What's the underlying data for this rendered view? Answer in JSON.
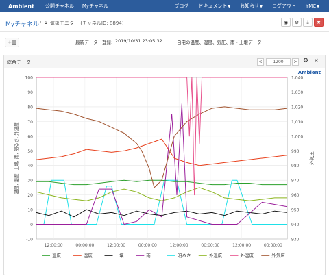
{
  "navbar": {
    "brand": "Ambient",
    "items": [
      "公開チャネル",
      "Myチャネル"
    ],
    "right_items": [
      {
        "label": "ブログ",
        "dropdown": false
      },
      {
        "label": "ドキュメント",
        "dropdown": true
      },
      {
        "label": "お知らせ",
        "dropdown": true
      },
      {
        "label": "ログアウト",
        "dropdown": false
      },
      {
        "label": "YMC",
        "dropdown": true
      }
    ]
  },
  "title": {
    "my_channel": "Myチャネル",
    "separator": "/",
    "channel_title": "気象モニター (チャネルID: 8894)"
  },
  "info": {
    "last_update_label": "最新データー登録:",
    "last_update": "2019/10/31 23:05:32",
    "description": "自宅の温度、湿度、気圧、雨・土壌データ"
  },
  "panel": {
    "title": "総合データ",
    "count": "1200",
    "prev": "<",
    "next": ">",
    "brand": "Ambient"
  },
  "colors": {
    "navbar": "#2c5c9c",
    "temp": "#2ca02c",
    "humidity": "#e8401c",
    "soil": "#111111",
    "rain": "#9b1f9b",
    "brightness": "#1fe0e8",
    "outdoor_temp": "#8ab41c",
    "outdoor_humidity": "#e8508c",
    "outdoor_pressure": "#a0522d"
  },
  "chart_data": {
    "type": "line",
    "x_ticks": [
      "12:00:00",
      "00:00:00",
      "12:00:00",
      "00:00:00",
      "12:00:00",
      "00:00:00",
      "12:00:00",
      "00:00:00"
    ],
    "y_left_label": "温度, 湿度, 土壌, 雨, 明るさ, 外温度",
    "y_left_ticks": [
      100,
      90,
      80,
      70,
      60,
      50,
      40,
      30,
      20,
      10,
      0,
      -10
    ],
    "y_left_range": [
      -10,
      100
    ],
    "y_right_label": "外気圧",
    "y_right_ticks_text": [
      "1,040",
      "1,030",
      "1,020",
      "1,010",
      "1,000",
      "990",
      "980",
      "970",
      "960",
      "950",
      "940",
      "930"
    ],
    "y_right_ticks": [
      1040,
      1030,
      1020,
      1010,
      1000,
      990,
      980,
      970,
      960,
      950,
      940,
      930
    ],
    "y_right_range": [
      930,
      1040
    ],
    "x_range": [
      0,
      1
    ],
    "grid": true,
    "legend_position": "bottom",
    "series": [
      {
        "name": "温度",
        "color": "#2ca02c",
        "axis": "left",
        "x": [
          0,
          0.05,
          0.1,
          0.15,
          0.2,
          0.25,
          0.3,
          0.35,
          0.4,
          0.45,
          0.5,
          0.55,
          0.6,
          0.65,
          0.7,
          0.75,
          0.8,
          0.85,
          0.9,
          0.95,
          1
        ],
        "y": [
          29,
          29,
          28,
          27,
          27,
          28,
          29,
          30,
          29,
          30,
          30,
          29,
          29,
          28,
          27,
          27,
          28,
          28,
          27,
          27,
          27
        ]
      },
      {
        "name": "湿度",
        "color": "#e8401c",
        "axis": "left",
        "x": [
          0,
          0.05,
          0.1,
          0.15,
          0.2,
          0.25,
          0.3,
          0.35,
          0.4,
          0.45,
          0.5,
          0.55,
          0.6,
          0.65,
          0.7,
          0.75,
          0.8,
          0.85,
          0.9,
          0.95,
          1
        ],
        "y": [
          44,
          45,
          46,
          48,
          51,
          50,
          49,
          50,
          52,
          55,
          58,
          45,
          42,
          40,
          41,
          42,
          43,
          44,
          45,
          46,
          47
        ]
      },
      {
        "name": "土壌",
        "color": "#111111",
        "axis": "left",
        "x": [
          0,
          0.05,
          0.1,
          0.15,
          0.2,
          0.25,
          0.3,
          0.35,
          0.4,
          0.45,
          0.5,
          0.55,
          0.6,
          0.65,
          0.7,
          0.75,
          0.8,
          0.85,
          0.9,
          0.95,
          1
        ],
        "y": [
          8,
          6,
          9,
          5,
          10,
          7,
          8,
          6,
          9,
          7,
          6,
          8,
          9,
          7,
          8,
          6,
          9,
          8,
          7,
          9,
          8
        ]
      },
      {
        "name": "雨",
        "color": "#9b1f9b",
        "axis": "left",
        "x": [
          0,
          0.1,
          0.2,
          0.25,
          0.3,
          0.35,
          0.4,
          0.45,
          0.5,
          0.52,
          0.54,
          0.56,
          0.58,
          0.6,
          0.7,
          0.8,
          0.9,
          1
        ],
        "y": [
          0,
          0,
          0,
          24,
          24,
          0,
          2,
          10,
          5,
          40,
          75,
          20,
          82,
          5,
          0,
          0,
          15,
          12
        ]
      },
      {
        "name": "明るさ",
        "color": "#1fe0e8",
        "axis": "left",
        "x": [
          0,
          0.03,
          0.06,
          0.11,
          0.14,
          0.2,
          0.24,
          0.28,
          0.3,
          0.34,
          0.4,
          0.44,
          0.47,
          0.51,
          0.56,
          0.6,
          0.64,
          0.7,
          0.74,
          0.78,
          0.8,
          0.86,
          0.9,
          0.96,
          1
        ],
        "y": [
          0,
          0,
          30,
          30,
          0,
          0,
          0,
          26,
          26,
          0,
          0,
          0,
          0,
          30,
          30,
          0,
          0,
          0,
          0,
          30,
          30,
          0,
          0,
          0,
          0
        ]
      },
      {
        "name": "外温度",
        "color": "#8ab41c",
        "axis": "left",
        "x": [
          0,
          0.05,
          0.1,
          0.15,
          0.2,
          0.25,
          0.3,
          0.35,
          0.4,
          0.45,
          0.5,
          0.55,
          0.6,
          0.65,
          0.7,
          0.75,
          0.8,
          0.85,
          0.9,
          0.95,
          1
        ],
        "y": [
          22,
          20,
          18,
          17,
          16,
          18,
          22,
          24,
          22,
          18,
          16,
          18,
          22,
          25,
          22,
          18,
          17,
          16,
          17,
          18,
          18
        ]
      },
      {
        "name": "外湿度",
        "color": "#e8508c",
        "axis": "left",
        "x": [
          0,
          0.6,
          0.61,
          0.62,
          0.63,
          0.64,
          0.65,
          0.66,
          0.67,
          1
        ],
        "y": [
          100,
          100,
          60,
          100,
          20,
          100,
          55,
          100,
          100,
          100
        ]
      },
      {
        "name": "外気圧",
        "color": "#a0522d",
        "axis": "right",
        "x": [
          0,
          0.05,
          0.1,
          0.15,
          0.2,
          0.25,
          0.3,
          0.35,
          0.4,
          0.42,
          0.45,
          0.47,
          0.5,
          0.53,
          0.55,
          0.6,
          0.65,
          0.7,
          0.75,
          0.8,
          0.85,
          0.9,
          0.95,
          1
        ],
        "y": [
          1019,
          1018,
          1017,
          1015,
          1012,
          1010,
          1006,
          1002,
          995,
          990,
          978,
          965,
          970,
          988,
          1000,
          1010,
          1015,
          1019,
          1020,
          1019,
          1018,
          1018,
          1018,
          1019
        ]
      }
    ]
  }
}
